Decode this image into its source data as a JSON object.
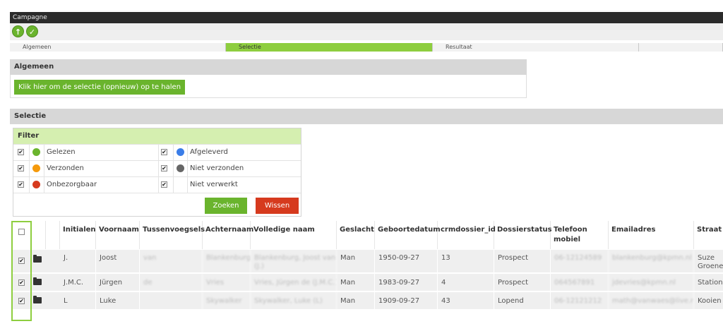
{
  "window": {
    "title": "Campagne"
  },
  "toolbar": {
    "up_glyph": "↑",
    "check_glyph": "✓"
  },
  "tabs": [
    {
      "label": "Algemeen"
    },
    {
      "label": "Selectie"
    },
    {
      "label": "Resultaat"
    },
    {
      "label": ""
    }
  ],
  "algemeen": {
    "title": "Algemeen",
    "fetch_button": "Klik hier om de selectie (opnieuw) op te halen"
  },
  "selectie": {
    "title": "Selectie",
    "filter": {
      "title": "Filter",
      "rows": [
        {
          "left": {
            "label": "Gelezen",
            "color": "#6ab42d"
          },
          "right": {
            "label": "Afgeleverd",
            "color": "#3a7de8"
          }
        },
        {
          "left": {
            "label": "Verzonden",
            "color": "#f59a0c"
          },
          "right": {
            "label": "Niet verzonden",
            "color": "#666666"
          }
        },
        {
          "left": {
            "label": "Onbezorgbaar",
            "color": "#d63a1e"
          },
          "right": {
            "label": "Niet verwerkt",
            "color": ""
          }
        }
      ],
      "search_button": "Zoeken",
      "clear_button": "Wissen",
      "check_glyph": "✔"
    }
  },
  "table": {
    "headers": [
      "Initialen",
      "Voornaam",
      "Tussenvoegsels",
      "Achternaam",
      "Volledige naam",
      "Geslacht",
      "Geboortedatum",
      "crmdossier_id",
      "Dossierstatus",
      "Telefoon mobiel",
      "Emailadres",
      "Straat"
    ],
    "rows": [
      {
        "initialen": "J.",
        "voornaam": "Joost",
        "tussenvoegsels": "van",
        "achternaam": "Blankenburg",
        "volledige_naam": "Blankenburg, Joost van (J.)",
        "geslacht": "Man",
        "geboortedatum": "1950-09-27",
        "crmdossier_id": "13",
        "dossierstatus": "Prospect",
        "telefoon": "06-12124589",
        "email": "blankenburg@kpmn.nl",
        "straat": "Suze Groene"
      },
      {
        "initialen": "J.M.C.",
        "voornaam": "Jürgen",
        "tussenvoegsels": "de",
        "achternaam": "Vries",
        "volledige_naam": "Vries, Jürgen de (J.M.C.)",
        "geslacht": "Man",
        "geboortedatum": "1983-09-27",
        "crmdossier_id": "4",
        "dossierstatus": "Prospect",
        "telefoon": "064567891",
        "email": "jdevries@kpmn.nl",
        "straat": "Station"
      },
      {
        "initialen": "L",
        "voornaam": "Luke",
        "tussenvoegsels": "",
        "achternaam": "Skywalker",
        "volledige_naam": "Skywalker, Luke (L)",
        "geslacht": "Man",
        "geboortedatum": "1909-09-27",
        "crmdossier_id": "43",
        "dossierstatus": "Lopend",
        "telefoon": "06-12121212",
        "email": "math@vanwaes@live.nl",
        "straat": "Kooien"
      }
    ]
  }
}
